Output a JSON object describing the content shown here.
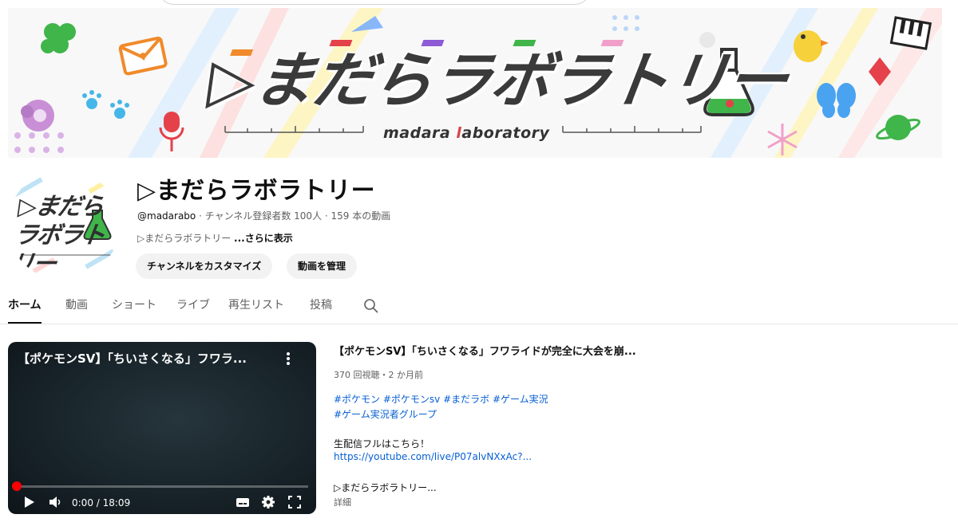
{
  "banner": {
    "title": "▷まだらラボラトリー",
    "subtitle_part1": "madara ",
    "subtitle_part2": "l",
    "subtitle_part3": "aboratory"
  },
  "avatar": {
    "line1": "▷まだら",
    "line2": "ラボラトリー"
  },
  "channel": {
    "name": "▷まだらラボラトリー",
    "handle": "@madarabo",
    "meta_rest": " · チャンネル登録者数 100人 · 159 本の動画",
    "desc": "▷まだらラボラトリー ",
    "more": "...さらに表示",
    "customize_button": "チャンネルをカスタマイズ",
    "manage_button": "動画を管理"
  },
  "tabs": [
    "ホーム",
    "動画",
    "ショート",
    "ライブ",
    "再生リスト",
    "投稿"
  ],
  "player": {
    "title": "【ポケモンSV】「ちいさくなる」フワラ...",
    "time": "0:00 / 18:09",
    "progress": 0
  },
  "video": {
    "title": "【ポケモンSV】「ちいさくなる」フワライドが完全に大会を崩...",
    "meta": "370 回視聴・2 か月前",
    "tags_line1": "#ポケモン #ポケモンsv #まだラボ  #ゲーム実況",
    "tags_line2": "#ゲーム実況者グループ",
    "live_text": "生配信フルはこちら！",
    "link": "https://youtube.com/live/P07alvNXxAc?...",
    "channel_line": "▷まだらラボラトリー...",
    "details": "詳細"
  },
  "colors": {
    "accent_red": "#ff0000",
    "link_blue": "#065fd4",
    "pill_bg": "#f2f2f2"
  }
}
